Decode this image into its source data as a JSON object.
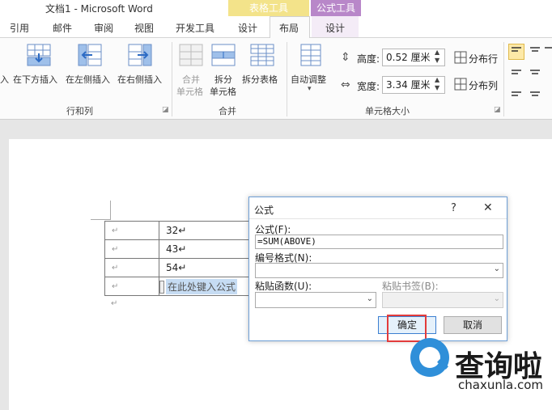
{
  "window": {
    "app_title": "文档1 - Microsoft Word",
    "context_table": "表格工具",
    "context_formula": "公式工具"
  },
  "tabs": [
    "引用",
    "邮件",
    "审阅",
    "视图",
    "开发工具",
    "设计",
    "布局",
    "设计"
  ],
  "ribbon": {
    "rows_cols": {
      "insert_below_partial": "入",
      "insert_below": "在下方插入",
      "insert_left": "在左侧插入",
      "insert_right": "在右侧插入",
      "group_label": "行和列"
    },
    "merge": {
      "merge_cells_1": "合并",
      "merge_cells_2": "单元格",
      "split_cells_1": "拆分",
      "split_cells_2": "单元格",
      "split_table": "拆分表格",
      "group_label": "合并"
    },
    "cell_size": {
      "autofit": "自动调整",
      "height_label": "高度:",
      "height_value": "0.52 厘米",
      "width_label": "宽度:",
      "width_value": "3.34 厘米",
      "distribute_rows": "分布行",
      "distribute_cols": "分布列",
      "group_label": "单元格大小"
    }
  },
  "document": {
    "table_rows": [
      {
        "c1": "↵",
        "c2": "32↵"
      },
      {
        "c1": "↵",
        "c2": "43↵"
      },
      {
        "c1": "↵",
        "c2": "54↵"
      },
      {
        "c1": "↵",
        "c2": "在此处键入公式"
      }
    ],
    "after_table_mark": "↵"
  },
  "dialog": {
    "title": "公式",
    "help": "?",
    "close": "✕",
    "formula_label": "公式(F):",
    "formula_value": "=SUM(ABOVE)",
    "number_format_label": "编号格式(N):",
    "paste_function_label": "粘贴函数(U):",
    "paste_bookmark_label": "粘贴书签(B):",
    "ok": "确定",
    "cancel": "取消"
  },
  "watermark": {
    "text": "查询啦",
    "url": "chaxunla.com"
  },
  "colors": {
    "ctx_table": "#f3e38a",
    "ctx_formula": "#b887c9",
    "highlight_red": "#e23b3b",
    "brand_blue": "#2f8fd9"
  }
}
